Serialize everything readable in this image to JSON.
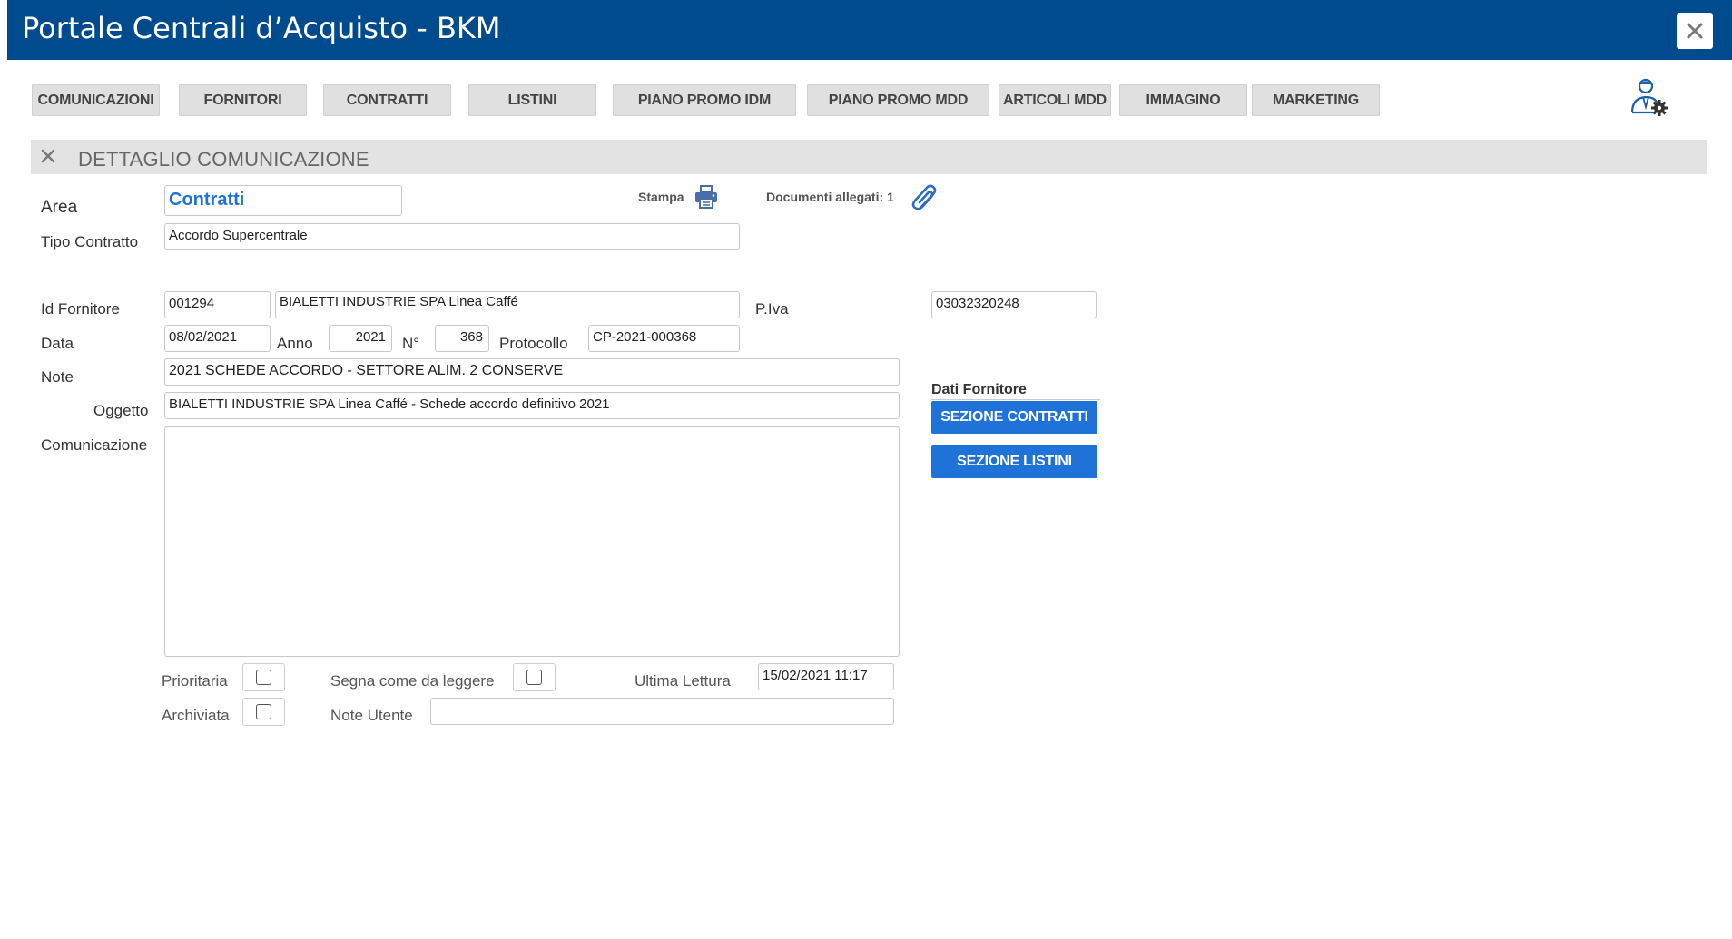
{
  "app": {
    "title": "Portale Centrali d’Acquisto - BKM"
  },
  "nav": [
    {
      "id": "comunicazioni",
      "label": "COMUNICAZIONI"
    },
    {
      "id": "fornitori",
      "label": "FORNITORI"
    },
    {
      "id": "contratti",
      "label": "CONTRATTI"
    },
    {
      "id": "listini",
      "label": "LISTINI"
    },
    {
      "id": "piano-promo-idm",
      "label": "PIANO PROMO IDM"
    },
    {
      "id": "piano-promo-mdd",
      "label": "PIANO PROMO MDD"
    },
    {
      "id": "articoli-mdd",
      "label": "ARTICOLI MDD"
    },
    {
      "id": "immagino",
      "label": "IMMAGINO"
    },
    {
      "id": "marketing",
      "label": "MARKETING"
    }
  ],
  "section": {
    "title": "DETTAGLIO COMUNICAZIONE"
  },
  "toolbar": {
    "print_label": "Stampa",
    "attachments_label": "Documenti allegati: 1"
  },
  "form": {
    "area": {
      "label": "Area",
      "value": "Contratti"
    },
    "tipo_contratto": {
      "label": "Tipo Contratto",
      "value": "Accordo Supercentrale"
    },
    "id_fornitore": {
      "label": "Id Fornitore",
      "value": "001294",
      "name_value": "BIALETTI INDUSTRIE SPA Linea Caffé"
    },
    "piva": {
      "label": "P.Iva",
      "value": "03032320248"
    },
    "data": {
      "label": "Data",
      "value": "08/02/2021"
    },
    "anno": {
      "label": "Anno",
      "value": "2021"
    },
    "numero": {
      "label": "N°",
      "value": "368"
    },
    "protocollo": {
      "label": "Protocollo",
      "value": "CP-2021-000368"
    },
    "note": {
      "label": "Note",
      "value": "2021 SCHEDE ACCORDO - SETTORE ALIM. 2 CONSERVE"
    },
    "oggetto": {
      "label": "Oggetto",
      "value": "BIALETTI INDUSTRIE SPA Linea Caffé - Schede accordo definitivo 2021"
    },
    "comunicazione": {
      "label": "Comunicazione",
      "value": ""
    },
    "prioritaria": {
      "label": "Prioritaria",
      "checked": false
    },
    "segna_da_leggere": {
      "label": "Segna come da leggere",
      "checked": false
    },
    "ultima_lettura": {
      "label": "Ultima Lettura",
      "value": "15/02/2021 11:17"
    },
    "archiviata": {
      "label": "Archiviata",
      "checked": false
    },
    "note_utente": {
      "label": "Note Utente",
      "value": ""
    }
  },
  "supplier": {
    "heading": "Dati Fornitore",
    "contracts_button": "SEZIONE CONTRATTI",
    "pricelists_button": "SEZIONE LISTINI"
  },
  "colors": {
    "titlebar": "#004b8d",
    "accent_blue": "#1f72d8",
    "area_text": "#1f72d8",
    "nav_bg": "#e0e0e0"
  },
  "icons": {
    "close": "close-icon",
    "user_settings": "user-gear-icon",
    "print": "printer-icon",
    "attachment": "paperclip-icon"
  }
}
